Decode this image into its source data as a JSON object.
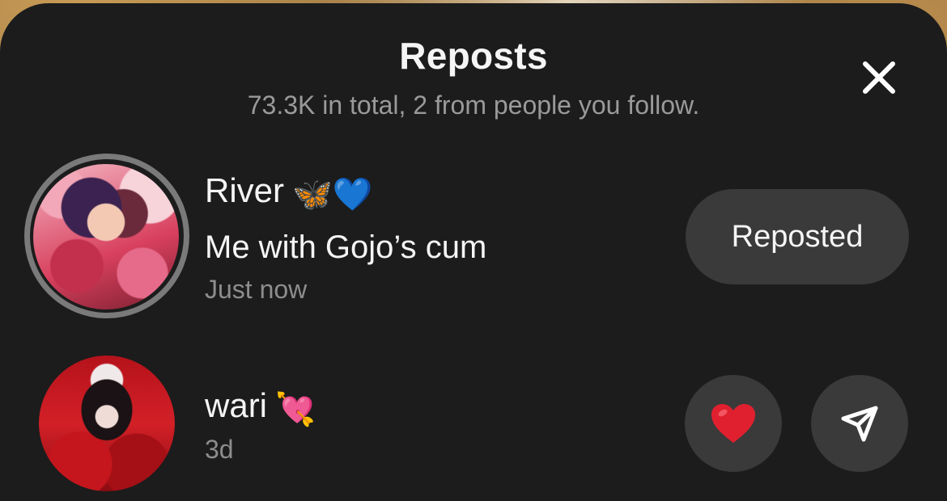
{
  "sheet": {
    "title": "Reposts",
    "subtitle": "73.3K in total, 2 from people you follow."
  },
  "reposts": [
    {
      "name": "River",
      "emoji": "🦋💙",
      "caption": "Me with Gojo’s cum",
      "time": "Just now",
      "action_label": "Reposted",
      "has_story_ring": true
    },
    {
      "name": "wari",
      "emoji": "💘",
      "time": "3d",
      "actions": [
        "heart-icon",
        "send-icon"
      ]
    }
  ],
  "colors": {
    "sheet_bg": "#1c1c1c",
    "button_bg": "#3a3a3a",
    "secondary_text": "#9a9a9a",
    "heart": "#e0202f"
  }
}
